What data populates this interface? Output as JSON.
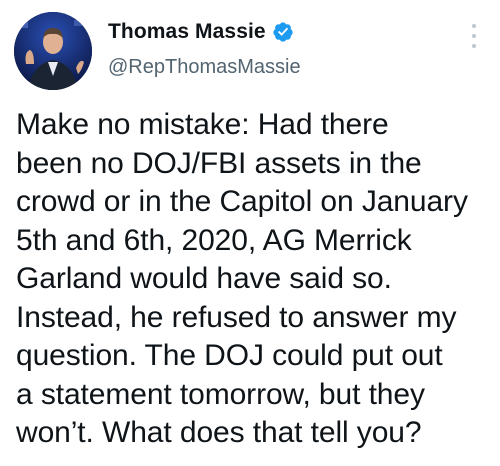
{
  "author": {
    "name": "Thomas Massie",
    "handle": "@RepThomasMassie",
    "verified": true,
    "verified_icon": "verified-badge-icon",
    "verified_color": "#1d9bf0"
  },
  "menu": {
    "icon": "more-vertical-icon"
  },
  "tweet": {
    "text": "Make no mistake: Had there\nbeen no DOJ/FBI assets in the\ncrowd or in the Capitol on January\n5th and 6th, 2020, AG Merrick\nGarland would have said so.\nInstead, he refused to answer my\nquestion. The DOJ could put out\na statement tomorrow, but they\nwon’t. What does that tell you?"
  },
  "colors": {
    "text_primary": "#0f1419",
    "text_secondary": "#536471",
    "accent": "#1d9bf0"
  }
}
